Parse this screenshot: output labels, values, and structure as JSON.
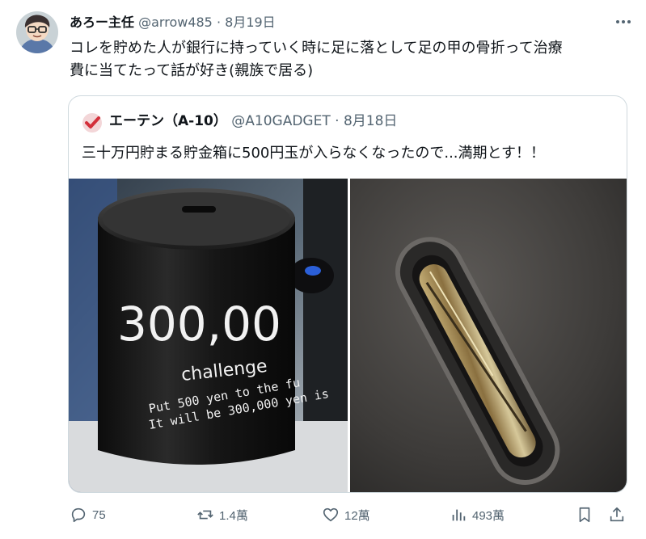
{
  "post": {
    "author_name": "あろー主任",
    "author_handle": "@arrow485",
    "separator": "·",
    "date": "8月19日",
    "text_line1": "コレを貯めた人が銀行に持っていく時に足に落として足の甲の骨折って治療",
    "text_line2": "費に当てたって話が好き(親族で居る)"
  },
  "quoted": {
    "author_name": "エーテン（A-10）",
    "author_handle": "@A10GADGET",
    "separator": "·",
    "date": "8月18日",
    "text": "三十万円貯まる貯金箱に500円玉が入らなくなったので...満期とす！！",
    "can_number": "300,00",
    "can_word": "challenge",
    "can_line1": "Put 500 yen to the fu",
    "can_line2": "It will be 300,000 yen is"
  },
  "actions": {
    "reply_count": "75",
    "repost_count": "1.4萬",
    "like_count": "12萬",
    "views_count": "493萬"
  },
  "icons": {
    "avatar": "avatar",
    "more": "more-icon",
    "quoted_avatar": "checkmark-avatar-icon",
    "reply": "reply-icon",
    "repost": "repost-icon",
    "like": "heart-icon",
    "views": "views-icon",
    "bookmark": "bookmark-icon",
    "share": "share-icon"
  },
  "colors": {
    "text": "#0f1419",
    "muted": "#536471",
    "border": "#cfd9de",
    "quoted_avatar_red": "#d32f3a"
  }
}
